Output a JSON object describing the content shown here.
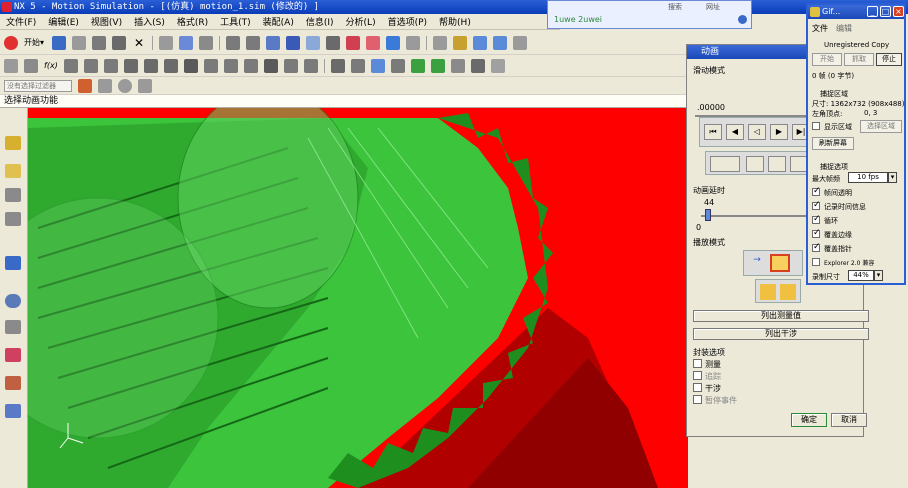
{
  "window": {
    "title": "NX 5 - Motion Simulation - [(仿真) motion_1.sim (修改的) ]"
  },
  "menu": [
    "文件(F)",
    "编辑(E)",
    "视图(V)",
    "插入(S)",
    "格式(R)",
    "工具(T)",
    "装配(A)",
    "信息(I)",
    "分析(L)",
    "首选项(P)",
    "帮助(H)"
  ],
  "toolbar": {
    "start_label": "开始▾",
    "fx_label": "f(x)",
    "filter_label": "没有选择过滤器"
  },
  "prompt": "选择动画功能",
  "popup": {
    "line1": "1uwe 2uwei",
    "search": "搜索",
    "site": "网址"
  },
  "animation": {
    "title": "动画",
    "slide_mode": "滑动模式",
    "position_value": ".00000",
    "delay_label": "动画延时",
    "delay_value": "44",
    "delay_min": "0",
    "playback_mode": "播放模式",
    "list_measurements": "列出测量值",
    "list_interference": "列出干涉",
    "stop_options": "封装选项",
    "opt_measure": "测量",
    "opt_trace": "追踪",
    "opt_interference": "干涉",
    "opt_pause_event": "暂停事件",
    "ok": "确定",
    "cancel": "取消"
  },
  "gif": {
    "title": "Gif...",
    "menu_file": "文件",
    "menu_edit": "编辑",
    "unregistered": "Unregistered Copy",
    "btn_start": "开始",
    "btn_capture": "抓取",
    "btn_stop": "停止",
    "frames": "0 帧 (0 字节)",
    "capture_area": "捕捉区域",
    "size": "尺寸: 1362x732 (908x488)",
    "topleft_label": "左角顶点:",
    "topleft_value": "0, 3",
    "show_area": "显示区域",
    "select_area": "选择区域",
    "refresh": "刷新屏幕",
    "capture_options": "捕捉选项",
    "max_fps_label": "最大帧频",
    "max_fps": "10 fps",
    "opt_transparent": "帧间透明",
    "opt_time": "记录时间信息",
    "opt_loop": "循环",
    "opt_border": "覆盖边缘",
    "opt_cursor": "覆盖指针",
    "opt_explorer": "Explorer 2.0 兼容",
    "record_size_label": "录制尺寸",
    "record_size": "44%"
  }
}
